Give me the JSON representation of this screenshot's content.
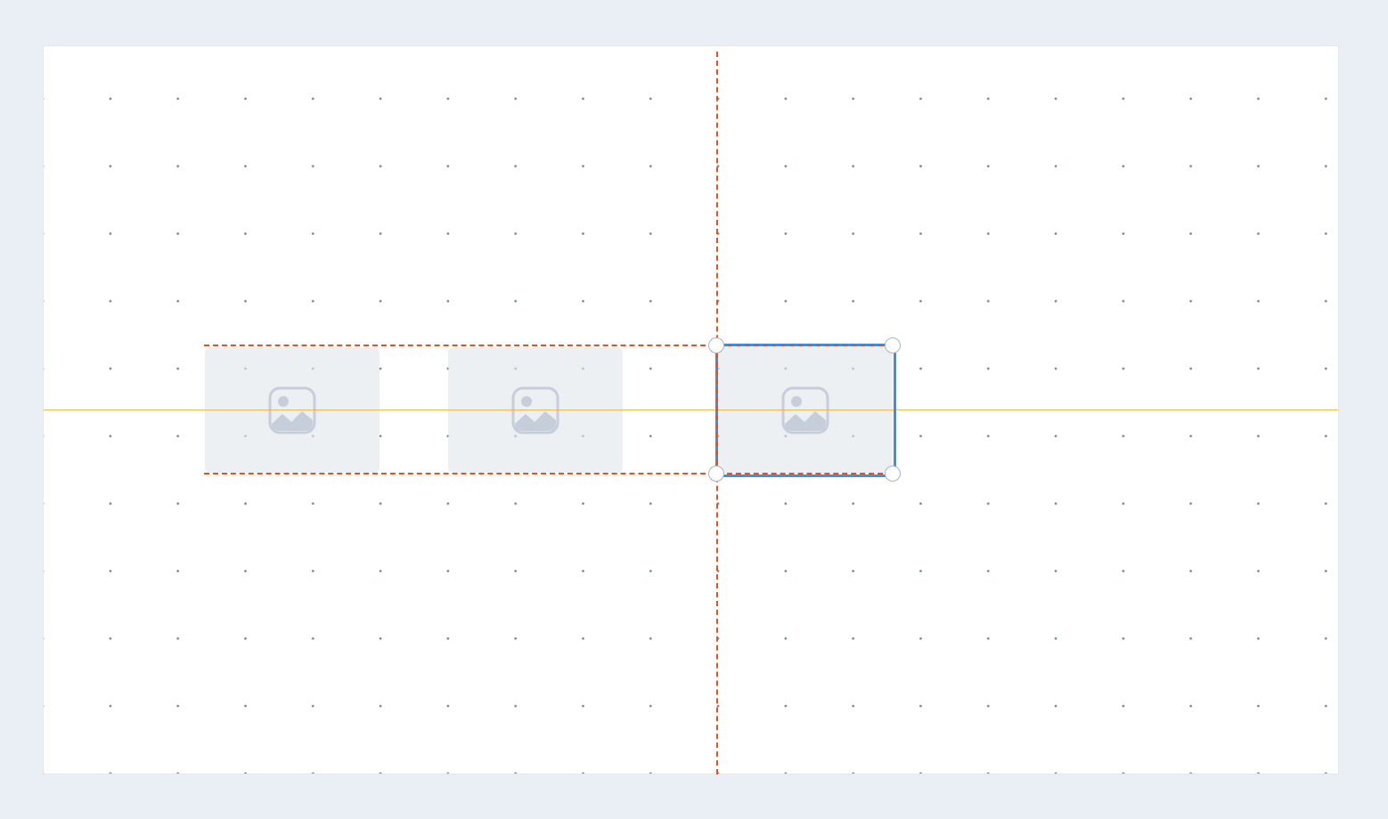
{
  "canvas": {
    "background": "#ffffff",
    "grid": "dot-grid"
  },
  "elements": [
    {
      "type": "image-placeholder",
      "icon": "image-icon",
      "selected": false
    },
    {
      "type": "image-placeholder",
      "icon": "image-icon",
      "selected": false
    },
    {
      "type": "image-placeholder",
      "icon": "image-icon",
      "selected": true
    }
  ],
  "guides": {
    "center_line_color": "#f6b54c",
    "alignment_guide_color": "#e8501c",
    "selection_color": "#3592e8"
  }
}
